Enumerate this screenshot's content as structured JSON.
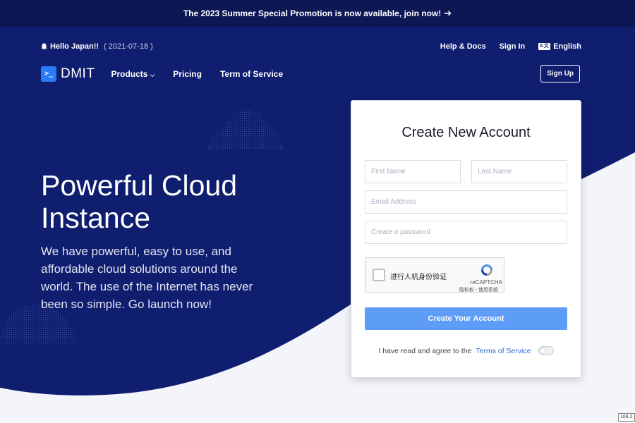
{
  "promo": {
    "text": "The 2023 Summer Special Promotion is now available, join now!",
    "arrow": "➔"
  },
  "topbar": {
    "greeting": "Hello Japan!!",
    "date": "( 2021-07-18 )",
    "links": {
      "help": "Help & Docs",
      "signin": "Sign In",
      "language": "English",
      "language_icon": "A文"
    }
  },
  "nav": {
    "brand": "DMIT",
    "logo_glyph": ">_",
    "items": {
      "products": "Products",
      "pricing": "Pricing",
      "terms": "Term of Service"
    },
    "signup": "Sign Up"
  },
  "hero": {
    "headline": "Powerful Cloud Instance",
    "subtext": "We have powerful, easy to use, and affordable cloud solutions around the world. The use of the Internet has never been so simple. Go launch now!"
  },
  "form": {
    "title": "Create New Account",
    "first_name_placeholder": "First Name",
    "last_name_placeholder": "Last Name",
    "email_placeholder": "Email Address",
    "password_placeholder": "Create a password",
    "captcha": {
      "label": "进行人机身份验证",
      "brand": "reCAPTCHA",
      "terms": "隐私权 - 使用条款"
    },
    "submit": "Create Your Account",
    "agree_text": "I have read and agree to the",
    "agree_link": "Terms of Service"
  },
  "corner_tag": "104.2",
  "colors": {
    "navy": "#0f1e6e",
    "promo_bar": "#0c1754",
    "accent": "#2a7cf6",
    "button": "#5d9df7",
    "link": "#2a6ad8"
  }
}
